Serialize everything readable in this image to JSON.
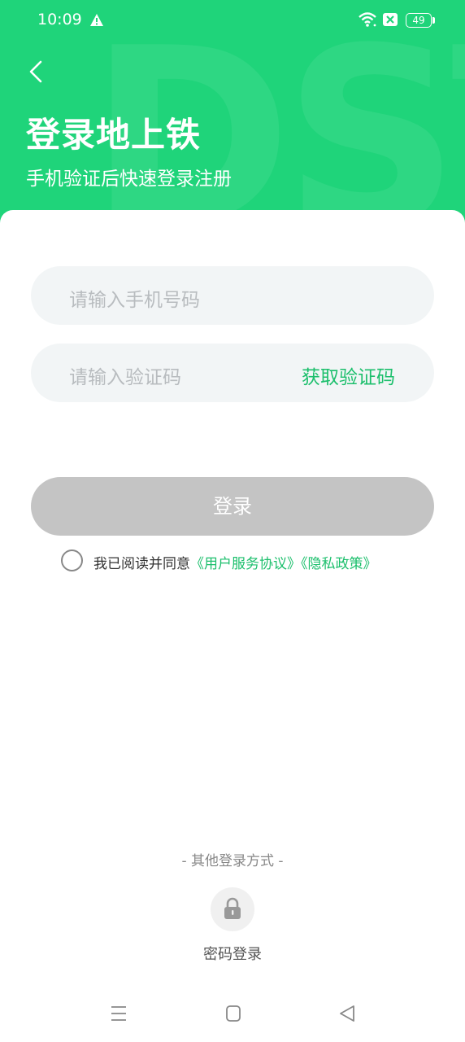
{
  "status_bar": {
    "time": "10:09",
    "battery": "49",
    "icons": [
      "warning-icon",
      "wifi-icon",
      "sim-x-icon",
      "battery-icon"
    ]
  },
  "header": {
    "title": "登录地上铁",
    "subtitle": "手机验证后快速登录注册",
    "color": "#1fd47a"
  },
  "form": {
    "phone_placeholder": "请输入手机号码",
    "code_placeholder": "请输入验证码",
    "get_code_label": "获取验证码",
    "login_label": "登录",
    "agreement_prefix": "我已阅读并同意",
    "user_agreement": "《用户服务协议》",
    "privacy_policy": "《隐私政策》"
  },
  "other_login": {
    "label": "- 其他登录方式 -",
    "password_login": "密码登录"
  },
  "colors": {
    "accent": "#1cbf6c",
    "button_disabled": "#c4c4c4",
    "input_bg": "#f2f5f6"
  }
}
